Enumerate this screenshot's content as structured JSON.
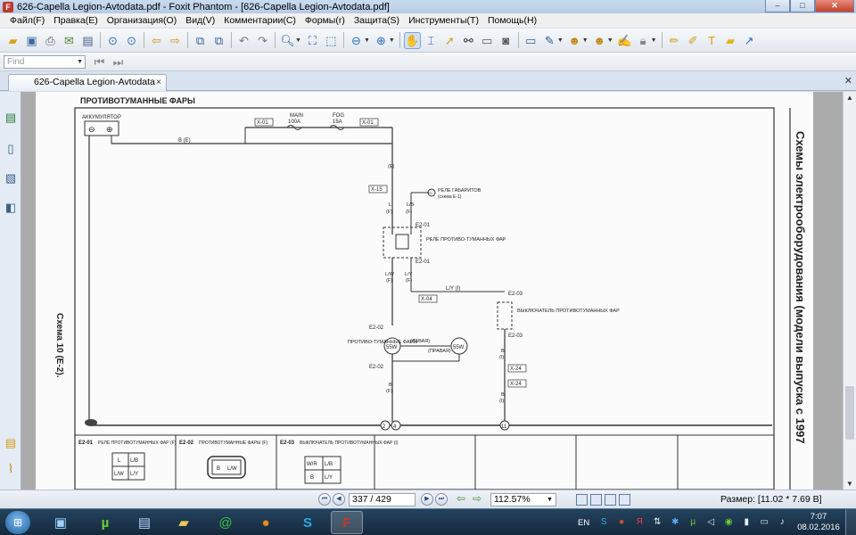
{
  "window": {
    "title": "626-Capella Legion-Avtodata.pdf - Foxit Phantom - [626-Capella Legion-Avtodata.pdf]",
    "buttons": {
      "minimize": "–",
      "maximize": "□",
      "close": "✕"
    }
  },
  "menu": [
    "Файл(F)",
    "Правка(E)",
    "Организация(O)",
    "Вид(V)",
    "Комментарии(C)",
    "Формы(r)",
    "Защита(S)",
    "Инструменты(T)",
    "Помощь(H)"
  ],
  "find": {
    "placeholder": "Find"
  },
  "tab": {
    "label": "626-Capella Legion-Avtodata",
    "close": "×"
  },
  "document": {
    "section_title": "ПРОТИВОТУМАННЫЕ ФАРЫ",
    "side_title": "Схемы электрооборудования (модели выпуска с 1997",
    "scheme_label": "Схема 10 (E-2).",
    "battery": "АККУМУЛЯТОР",
    "fuse_main": {
      "name": "MAIN",
      "rating": "100A"
    },
    "fuse_fog": {
      "name": "FOG",
      "rating": "15A"
    },
    "connectors": [
      "X-01",
      "X-01",
      "X-15",
      "X-04",
      "X-24",
      "X-24"
    ],
    "wire_codes": {
      "b_e": "B (E)",
      "e": "(E)",
      "l_f": "L",
      "lb_f": "L/B",
      "lw": "L/W",
      "ly": "L/Y",
      "ly_i": "L/Y (I)",
      "b_f": "B",
      "b_i": "B",
      "f": "(F)",
      "i": "(I)"
    },
    "relay_side": {
      "label": "РЕЛЕ ГАБАРИТОВ",
      "sub": "(схема E-1)",
      "code": "E2"
    },
    "nodes": {
      "e201": "E2-01",
      "e202": "E2-02",
      "e203": "E2-03"
    },
    "relay_label": "РЕЛЕ ПРОТИВО-ТУМАННЫХ ФАР",
    "switch_label": "ВЫКЛЮЧАТЕЛЬ ПРОТИВОТУМАННЫХ ФАР",
    "lamps_label": "ПРОТИВО-ТУМАННЫЕ ФАРЫ",
    "lamp_left": {
      "value": "55W",
      "side": "(ЛЕВАЯ)"
    },
    "lamp_right": {
      "value": "55W",
      "side": "(ПРАВАЯ)"
    },
    "grounds": [
      "2",
      "4",
      "11"
    ],
    "footer": [
      {
        "code": "E2-01",
        "name": "РЕЛЕ ПРОТИВОТУМАННЫХ ФАР (F)",
        "pins": [
          "L",
          "L/B",
          "L/W",
          "L/Y"
        ]
      },
      {
        "code": "E2-02",
        "name": "ПРОТИВОТУМАННЫЕ ФАРЫ (F)",
        "pins": [
          "B",
          "L/W"
        ]
      },
      {
        "code": "E2-03",
        "name": "ВЫКЛЮЧАТЕЛЬ ПРОТИВОТУМАННЫХ ФАР (I)",
        "pins": [
          "W/R",
          "L/B",
          "B",
          "L/Y"
        ]
      }
    ]
  },
  "status": {
    "page": "337 / 429",
    "zoom": "112.57%",
    "size": "Размер: [11.02 * 7.69 В]"
  },
  "taskbar": {
    "language": "EN",
    "time": "7:07",
    "date": "08.02.2016"
  }
}
